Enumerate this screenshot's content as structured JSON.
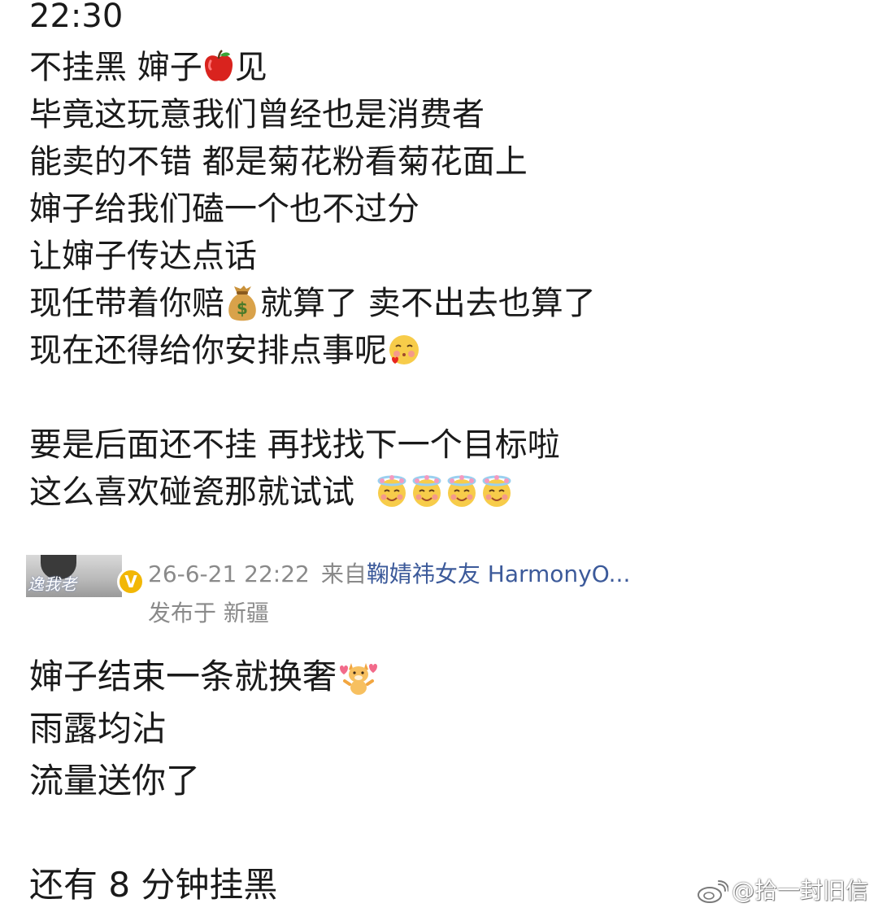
{
  "post": {
    "time": "22:30",
    "lines": [
      {
        "text": "不挂黑 婶子",
        "emoji": "apple-emoji",
        "after": "见"
      },
      {
        "text": "毕竟这玩意我们曾经也是消费者"
      },
      {
        "text": "能卖的不错 都是菊花粉看菊花面上"
      },
      {
        "text": "婶子给我们磕一个也不过分"
      },
      {
        "text": "让婶子传达点话"
      },
      {
        "text": "现任带着你赔",
        "emoji": "money-bag-emoji",
        "after": "就算了 卖不出去也算了"
      },
      {
        "text": "现在还得给你安排点事呢",
        "emoji": "blush-face-emoji"
      },
      {
        "text": "要是后面还不挂 再找找下一个目标啦"
      },
      {
        "text": "这么喜欢碰瓷那就试试",
        "emoji": "halo-face-emoji",
        "emoji_count": 4
      }
    ]
  },
  "meta": {
    "avatar_text": "逸我老",
    "verified": "V",
    "timestamp": "26-6-21 22:22",
    "from_label": "来自",
    "source": "鞠婧祎女友 HarmonyO...",
    "location": "发布于 新疆"
  },
  "reply": {
    "lines": [
      {
        "text": "婶子结束一条就换奢",
        "emoji": "dog-hearts-emoji"
      },
      {
        "text": "雨露均沾"
      },
      {
        "text": "流量送你了"
      },
      {
        "text": "还有 8 分钟挂黑"
      }
    ]
  },
  "watermark": {
    "text": "@拾一封旧信",
    "icon": "weibo-logo-icon"
  },
  "colors": {
    "text": "#1a1a1a",
    "meta_gray": "#8a8a8a",
    "source_blue": "#3c5a9a",
    "verified_gold": "#f2b705"
  }
}
